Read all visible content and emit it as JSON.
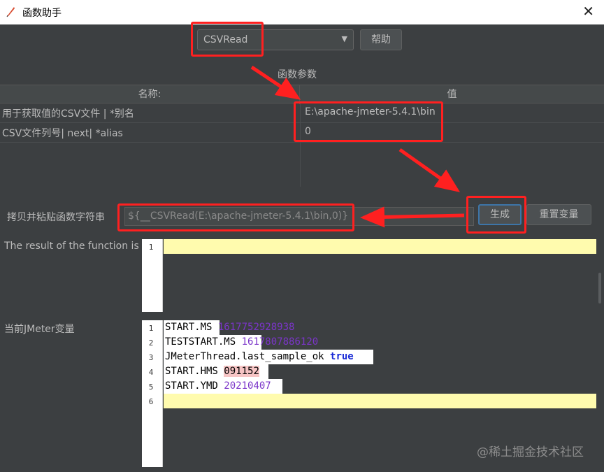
{
  "window": {
    "title": "函数助手",
    "close_glyph": "✕"
  },
  "toolbar": {
    "function_select": "CSVRead",
    "help_label": "帮助"
  },
  "params": {
    "section_title": "函数参数",
    "col_name": "名称:",
    "col_value": "值",
    "rows": [
      {
        "name": "用于获取值的CSV文件 | *别名",
        "value": "E:\\apache-jmeter-5.4.1\\bin"
      },
      {
        "name": "CSV文件列号| next| *alias",
        "value": "0"
      }
    ]
  },
  "copy": {
    "label": "拷贝并粘贴函数字符串",
    "value": "${__CSVRead(E:\\apache-jmeter-5.4.1\\bin,0)}",
    "generate_label": "生成",
    "reset_label": "重置变量"
  },
  "result": {
    "label": "The result of the function is",
    "lines": [
      "1"
    ]
  },
  "vars": {
    "label": "当前JMeter变量",
    "line_numbers": [
      "1",
      "2",
      "3",
      "4",
      "5",
      "6"
    ],
    "lines": [
      {
        "key": "START.MS",
        "value": "1617752928938"
      },
      {
        "key": "TESTSTART.MS",
        "value": "1617807886120"
      },
      {
        "key": "JMeterThread.last_sample_ok",
        "value": "true"
      },
      {
        "key": "START.HMS",
        "value": "091152"
      },
      {
        "key": "START.YMD",
        "value": "20210407"
      }
    ]
  },
  "watermark": "@稀土掘金技术社区",
  "colors": {
    "annotation_red": "#ff2020",
    "background": "#3c3f41",
    "highlight_line": "#fffbae"
  }
}
